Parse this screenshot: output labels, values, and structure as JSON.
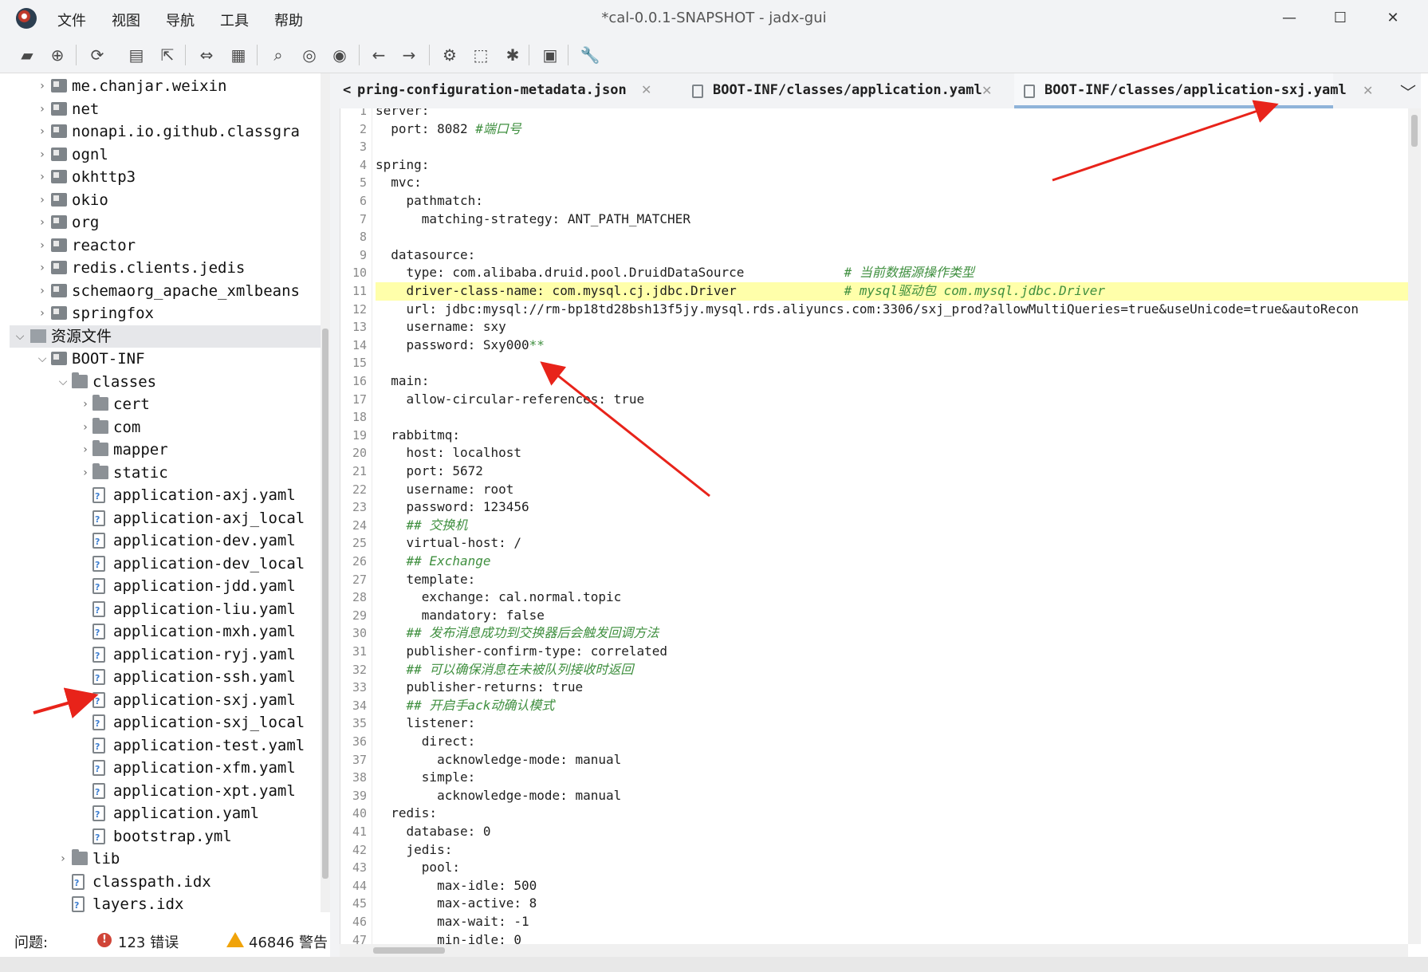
{
  "window": {
    "title": "*cal-0.0.1-SNAPSHOT - jadx-gui",
    "menu": [
      "文件",
      "视图",
      "导航",
      "工具",
      "帮助"
    ],
    "controls": [
      "—",
      "☐",
      "✕"
    ]
  },
  "toolbar": {
    "icons": [
      "open-icon",
      "add-files-icon",
      "sync-icon",
      "save-icon",
      "export-icon",
      "flatten-packages-icon",
      "package-view-icon",
      "search-icon",
      "find-class-icon",
      "find-usage-icon",
      "back-icon",
      "forward-icon",
      "deobfuscation-icon",
      "decompile-all-icon",
      "debug-icon",
      "log-icon",
      "settings-icon"
    ]
  },
  "tree": {
    "items": [
      {
        "label": "me.chanjar.weixin",
        "type": "pkg",
        "depth": 1,
        "twisty": ">"
      },
      {
        "label": "net",
        "type": "pkg",
        "depth": 1,
        "twisty": ">"
      },
      {
        "label": "nonapi.io.github.classgra",
        "type": "pkg",
        "depth": 1,
        "twisty": ">"
      },
      {
        "label": "ognl",
        "type": "pkg",
        "depth": 1,
        "twisty": ">"
      },
      {
        "label": "okhttp3",
        "type": "pkg",
        "depth": 1,
        "twisty": ">"
      },
      {
        "label": "okio",
        "type": "pkg",
        "depth": 1,
        "twisty": ">"
      },
      {
        "label": "org",
        "type": "pkg",
        "depth": 1,
        "twisty": ">"
      },
      {
        "label": "reactor",
        "type": "pkg",
        "depth": 1,
        "twisty": ">"
      },
      {
        "label": "redis.clients.jedis",
        "type": "pkg",
        "depth": 1,
        "twisty": ">"
      },
      {
        "label": "schemaorg_apache_xmlbeans",
        "type": "pkg",
        "depth": 1,
        "twisty": ">"
      },
      {
        "label": "springfox",
        "type": "pkg",
        "depth": 1,
        "twisty": ">"
      },
      {
        "label": "资源文件",
        "type": "res",
        "depth": 0,
        "twisty": "v",
        "selected": true
      },
      {
        "label": "BOOT-INF",
        "type": "pkg",
        "depth": 1,
        "twisty": "v"
      },
      {
        "label": "classes",
        "type": "folder",
        "depth": 2,
        "twisty": "v"
      },
      {
        "label": "cert",
        "type": "folder",
        "depth": 3,
        "twisty": ">"
      },
      {
        "label": "com",
        "type": "folder",
        "depth": 3,
        "twisty": ">"
      },
      {
        "label": "mapper",
        "type": "folder",
        "depth": 3,
        "twisty": ">"
      },
      {
        "label": "static",
        "type": "folder",
        "depth": 3,
        "twisty": ">"
      },
      {
        "label": "application-axj.yaml",
        "type": "file",
        "depth": 3
      },
      {
        "label": "application-axj_local",
        "type": "file",
        "depth": 3
      },
      {
        "label": "application-dev.yaml",
        "type": "file",
        "depth": 3
      },
      {
        "label": "application-dev_local",
        "type": "file",
        "depth": 3
      },
      {
        "label": "application-jdd.yaml",
        "type": "file",
        "depth": 3
      },
      {
        "label": "application-liu.yaml",
        "type": "file",
        "depth": 3
      },
      {
        "label": "application-mxh.yaml",
        "type": "file",
        "depth": 3
      },
      {
        "label": "application-ryj.yaml",
        "type": "file",
        "depth": 3
      },
      {
        "label": "application-ssh.yaml",
        "type": "file",
        "depth": 3
      },
      {
        "label": "application-sxj.yaml",
        "type": "file",
        "depth": 3
      },
      {
        "label": "application-sxj_local",
        "type": "file",
        "depth": 3
      },
      {
        "label": "application-test.yaml",
        "type": "file",
        "depth": 3
      },
      {
        "label": "application-xfm.yaml",
        "type": "file",
        "depth": 3
      },
      {
        "label": "application-xpt.yaml",
        "type": "file",
        "depth": 3
      },
      {
        "label": "application.yaml",
        "type": "file",
        "depth": 3
      },
      {
        "label": "bootstrap.yml",
        "type": "file",
        "depth": 3
      },
      {
        "label": "lib",
        "type": "folder",
        "depth": 2,
        "twisty": ">"
      },
      {
        "label": "classpath.idx",
        "type": "file",
        "depth": 2
      },
      {
        "label": "layers.idx",
        "type": "file",
        "depth": 2
      }
    ]
  },
  "status": {
    "problems_label": "问题:",
    "errors": "123 错误",
    "warnings": "46846 警告"
  },
  "tabs": [
    {
      "label": "pring-configuration-metadata.json",
      "active": false,
      "prefix": "<"
    },
    {
      "label": "BOOT-INF/classes/application.yaml",
      "active": false
    },
    {
      "label": "BOOT-INF/classes/application-sxj.yaml",
      "active": true
    }
  ],
  "tab_overflow": "﹀",
  "editor": {
    "highlighted_line": 11,
    "lines": [
      {
        "code": "server:",
        "comment": ""
      },
      {
        "code": "  port: 8082 ",
        "comment": "#端口号"
      },
      {
        "code": "",
        "comment": ""
      },
      {
        "code": "spring:",
        "comment": ""
      },
      {
        "code": "  mvc:",
        "comment": ""
      },
      {
        "code": "    pathmatch:",
        "comment": ""
      },
      {
        "code": "      matching-strategy: ANT_PATH_MATCHER",
        "comment": ""
      },
      {
        "code": "",
        "comment": ""
      },
      {
        "code": "  datasource:",
        "comment": ""
      },
      {
        "code": "    type: com.alibaba.druid.pool.DruidDataSource             ",
        "comment": "# 当前数据源操作类型"
      },
      {
        "code": "    driver-class-name: com.mysql.cj.jdbc.Driver              ",
        "comment": "# mysql驱动包 com.mysql.jdbc.Driver"
      },
      {
        "code": "    url: jdbc:mysql://rm-bp18td28bsh13f5jy.mysql.rds.aliyuncs.com:3306/sxj_prod?allowMultiQueries=true&useUnicode=true&autoRecon",
        "comment": ""
      },
      {
        "code": "    username: sxy",
        "comment": ""
      },
      {
        "code": "    password: Sxy000",
        "comment": "**"
      },
      {
        "code": "",
        "comment": ""
      },
      {
        "code": "  main:",
        "comment": ""
      },
      {
        "code": "    allow-circular-references: true",
        "comment": ""
      },
      {
        "code": "",
        "comment": ""
      },
      {
        "code": "  rabbitmq:",
        "comment": ""
      },
      {
        "code": "    host: localhost",
        "comment": ""
      },
      {
        "code": "    port: 5672",
        "comment": ""
      },
      {
        "code": "    username: root",
        "comment": ""
      },
      {
        "code": "    password: 123456",
        "comment": ""
      },
      {
        "code": "    ",
        "comment": "## 交换机"
      },
      {
        "code": "    virtual-host: /",
        "comment": ""
      },
      {
        "code": "    ",
        "comment": "## Exchange"
      },
      {
        "code": "    template:",
        "comment": ""
      },
      {
        "code": "      exchange: cal.normal.topic",
        "comment": ""
      },
      {
        "code": "      mandatory: false",
        "comment": ""
      },
      {
        "code": "    ",
        "comment": "## 发布消息成功到交换器后会触发回调方法"
      },
      {
        "code": "    publisher-confirm-type: correlated",
        "comment": ""
      },
      {
        "code": "    ",
        "comment": "## 可以确保消息在未被队列接收时返回"
      },
      {
        "code": "    publisher-returns: true",
        "comment": ""
      },
      {
        "code": "    ",
        "comment": "## 开启手ack动确认模式"
      },
      {
        "code": "    listener:",
        "comment": ""
      },
      {
        "code": "      direct:",
        "comment": ""
      },
      {
        "code": "        acknowledge-mode: manual",
        "comment": ""
      },
      {
        "code": "      simple:",
        "comment": ""
      },
      {
        "code": "        acknowledge-mode: manual",
        "comment": ""
      },
      {
        "code": "  redis:",
        "comment": ""
      },
      {
        "code": "    database: 0",
        "comment": ""
      },
      {
        "code": "    jedis:",
        "comment": ""
      },
      {
        "code": "      pool:",
        "comment": ""
      },
      {
        "code": "        max-idle: 500",
        "comment": ""
      },
      {
        "code": "        max-active: 8",
        "comment": ""
      },
      {
        "code": "        max-wait: -1",
        "comment": ""
      },
      {
        "code": "        min-idle: 0",
        "comment": ""
      }
    ]
  },
  "colors": {
    "comment": "#3f8f3f",
    "highlight": "#ffffaa",
    "annotation_arrow": "#e8231a",
    "active_tab_underline": "#8fb3d9"
  }
}
